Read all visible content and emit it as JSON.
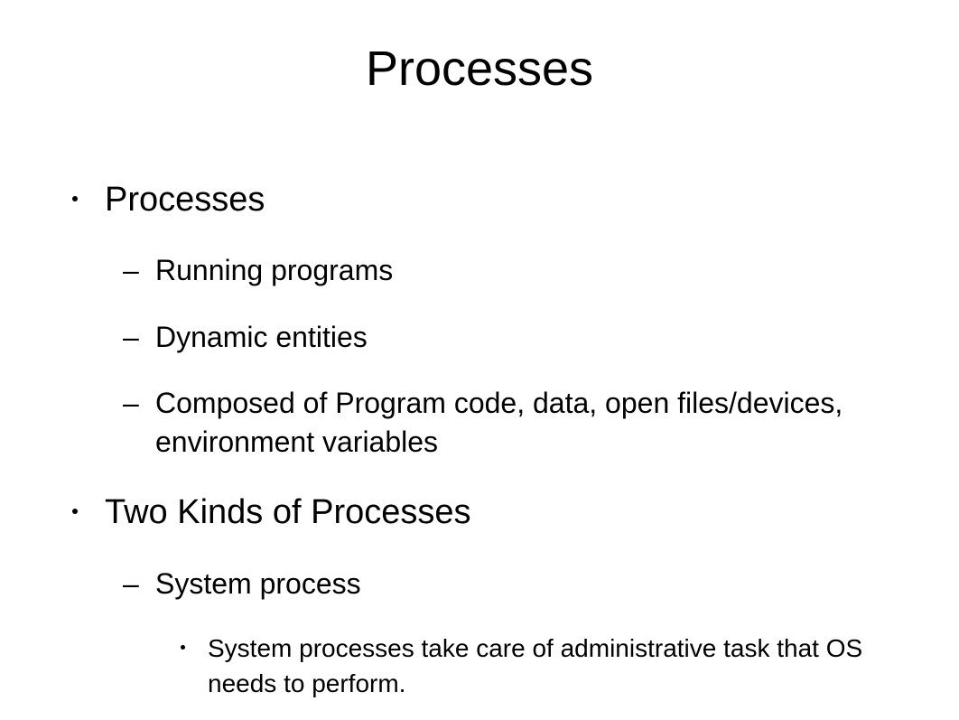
{
  "title": "Processes",
  "bullets": {
    "b1": "Processes",
    "b1_1": "Running programs",
    "b1_2": "Dynamic entities",
    "b1_3": "Composed of Program code, data, open files/devices, environment variables",
    "b2": "Two Kinds of Processes",
    "b2_1": "System process",
    "b2_1_1": "System processes take care of administrative task that OS needs to perform."
  }
}
